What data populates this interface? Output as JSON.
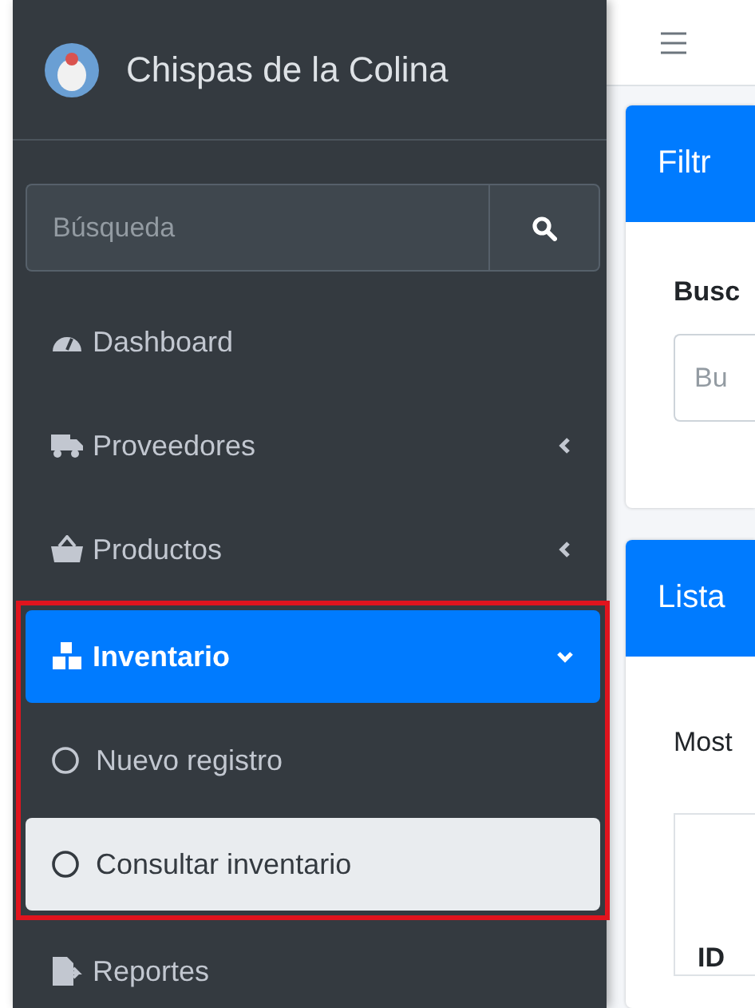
{
  "sidebar": {
    "brand": "Chispas de la Colina",
    "search": {
      "placeholder": "Búsqueda"
    },
    "items": [
      {
        "label": "Dashboard",
        "kind": "link",
        "selected": false
      },
      {
        "label": "Proveedores",
        "kind": "group",
        "expanded": false,
        "selected": false
      },
      {
        "label": "Productos",
        "kind": "group",
        "expanded": false,
        "selected": false
      },
      {
        "label": "Inventario",
        "kind": "group",
        "expanded": true,
        "selected": true,
        "highlighted": true,
        "children": [
          {
            "label": "Nuevo registro",
            "selected": false
          },
          {
            "label": "Consultar inventario",
            "selected": true
          }
        ]
      },
      {
        "label": "Reportes",
        "kind": "link",
        "selected": false
      }
    ]
  },
  "main": {
    "filter_card": {
      "title": "Filtr",
      "field_label": "Busc",
      "placeholder": "Bu"
    },
    "list_card": {
      "title": "Lista",
      "text": "Most",
      "column_1": "ID"
    }
  }
}
